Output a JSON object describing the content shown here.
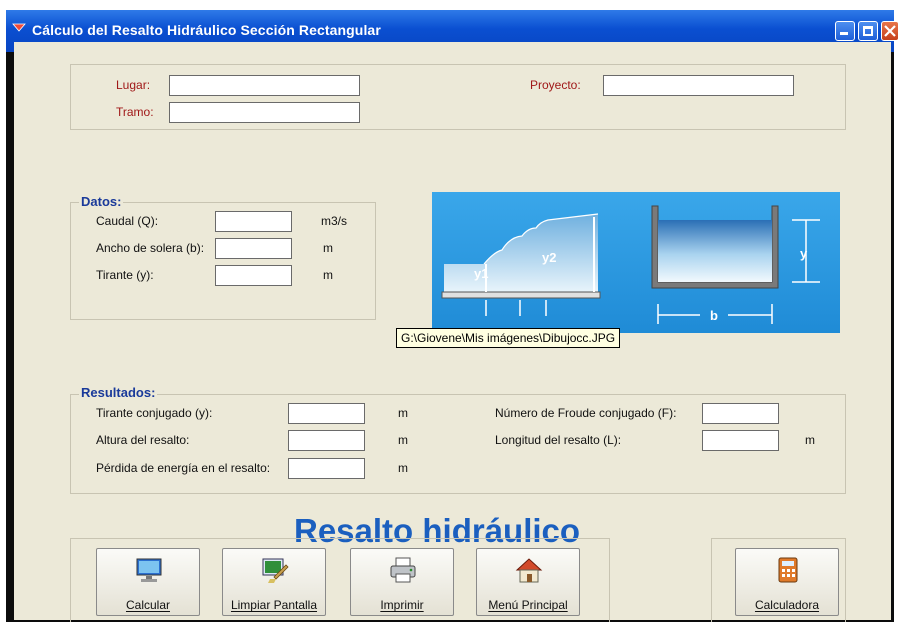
{
  "window": {
    "title": "Cálculo del Resalto Hidráulico Sección Rectangular"
  },
  "header": {
    "lugar_label": "Lugar:",
    "lugar_value": "",
    "tramo_label": "Tramo:",
    "tramo_value": "",
    "proyecto_label": "Proyecto:",
    "proyecto_value": ""
  },
  "datos": {
    "title": "Datos:",
    "rows": [
      {
        "label": "Caudal (Q):",
        "value": "",
        "unit": "m3/s"
      },
      {
        "label": "Ancho de solera (b):",
        "value": "",
        "unit": "m"
      },
      {
        "label": "Tirante (y):",
        "value": "",
        "unit": "m"
      }
    ]
  },
  "diagram": {
    "labels": {
      "y1": "y1",
      "y2": "y2",
      "y": "y",
      "b": "b"
    },
    "tooltip": "G:\\Giovene\\Mis imágenes\\Dibujocc.JPG"
  },
  "resultados": {
    "title": "Resultados:",
    "left": [
      {
        "label": "Tirante conjugado (y):",
        "value": "",
        "unit": "m"
      },
      {
        "label": "Altura del resalto:",
        "value": "",
        "unit": "m"
      },
      {
        "label": "Pérdida de energía en el resalto:",
        "value": "",
        "unit": "m"
      }
    ],
    "right": [
      {
        "label": "Número de Froude conjugado (F):",
        "value": "",
        "unit": ""
      },
      {
        "label": "Longitud del resalto (L):",
        "value": "",
        "unit": "m"
      }
    ]
  },
  "banner": "Resalto hidráulico",
  "buttons": {
    "calcular": {
      "label": "Calcular",
      "icon": "monitor-icon"
    },
    "limpiar": {
      "label": "Limpiar Pantalla",
      "icon": "broom-screen-icon"
    },
    "imprimir": {
      "label": "Imprimir",
      "icon": "printer-icon"
    },
    "menu": {
      "label": "Menú Principal",
      "icon": "home-icon"
    },
    "calculadora": {
      "label": "Calculadora",
      "icon": "calculator-icon"
    }
  },
  "colors": {
    "title_bar": "#0a4fd1",
    "panel": "#ece9d8",
    "diagram_bg": "#2d9be2",
    "banner": "#1b5fbf",
    "group_title": "#1a3a9a"
  }
}
